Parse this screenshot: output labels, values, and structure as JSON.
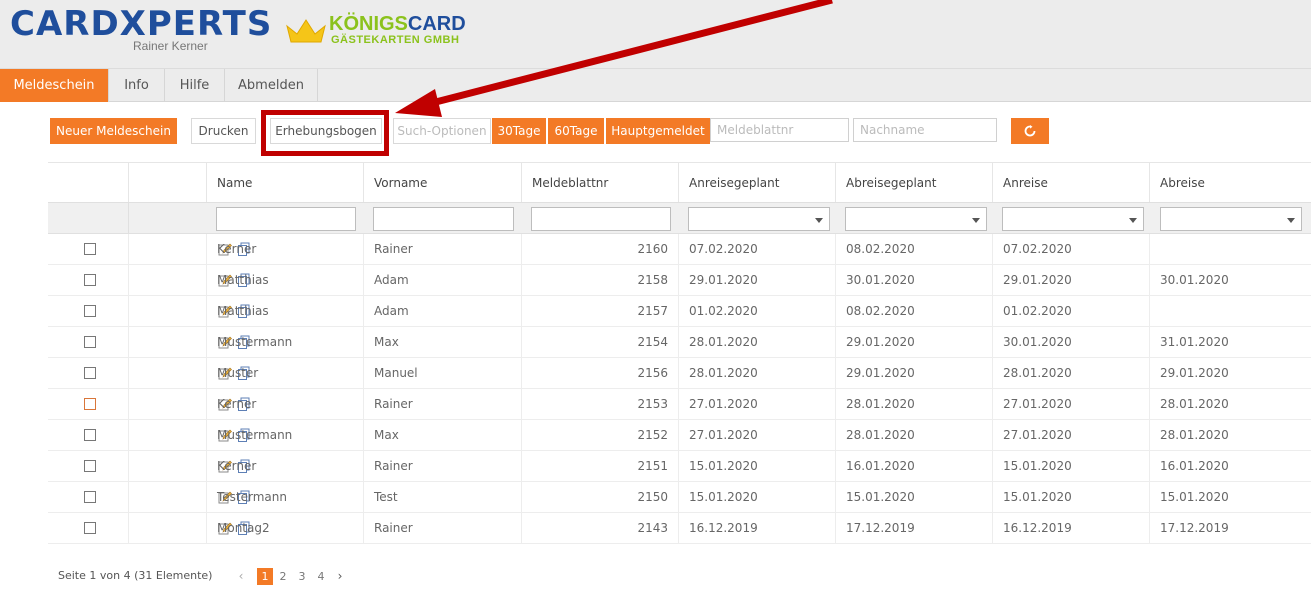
{
  "logo": {
    "brand": "CARDXPERTS",
    "owner": "Rainer Kerner",
    "partner_prefix": "KÖNIGS",
    "partner_suffix": "CARD",
    "partner_sub": "GÄSTEKARTEN GMBH"
  },
  "nav": {
    "items": [
      {
        "label": "Meldeschein",
        "active": true
      },
      {
        "label": "Info",
        "active": false
      },
      {
        "label": "Hilfe",
        "active": false
      },
      {
        "label": "Abmelden",
        "active": false
      }
    ]
  },
  "toolbar": {
    "new_label": "Neuer Meldeschein",
    "print_label": "Drucken",
    "survey_label": "Erhebungsbogen",
    "search_options_label": "Such-Optionen",
    "days30_label": "30Tage",
    "days60_label": "60Tage",
    "main_label": "Hauptgemeldet",
    "meldeblatt_placeholder": "Meldeblattnr",
    "name_placeholder": "Nachname",
    "refresh_icon": "refresh-icon"
  },
  "grid": {
    "columns": [
      "",
      "",
      "Name",
      "Vorname",
      "Meldeblattnr",
      "Anreisegeplant",
      "Abreisegeplant",
      "Anreise",
      "Abreise"
    ],
    "rows": [
      {
        "name": "Kerner",
        "vorname": "Rainer",
        "nr": "2160",
        "anreise_geplant": "07.02.2020",
        "abreise_geplant": "08.02.2020",
        "anreise": "07.02.2020",
        "abreise": ""
      },
      {
        "name": "Matthias",
        "vorname": "Adam",
        "nr": "2158",
        "anreise_geplant": "29.01.2020",
        "abreise_geplant": "30.01.2020",
        "anreise": "29.01.2020",
        "abreise": "30.01.2020"
      },
      {
        "name": "Matthias",
        "vorname": "Adam",
        "nr": "2157",
        "anreise_geplant": "01.02.2020",
        "abreise_geplant": "08.02.2020",
        "anreise": "01.02.2020",
        "abreise": ""
      },
      {
        "name": "Mustermann",
        "vorname": "Max",
        "nr": "2154",
        "anreise_geplant": "28.01.2020",
        "abreise_geplant": "29.01.2020",
        "anreise": "30.01.2020",
        "abreise": "31.01.2020"
      },
      {
        "name": "Muster",
        "vorname": "Manuel",
        "nr": "2156",
        "anreise_geplant": "28.01.2020",
        "abreise_geplant": "29.01.2020",
        "anreise": "28.01.2020",
        "abreise": "29.01.2020"
      },
      {
        "name": "Kerner",
        "vorname": "Rainer",
        "nr": "2153",
        "anreise_geplant": "27.01.2020",
        "abreise_geplant": "28.01.2020",
        "anreise": "27.01.2020",
        "abreise": "28.01.2020"
      },
      {
        "name": "Mustermann",
        "vorname": "Max",
        "nr": "2152",
        "anreise_geplant": "27.01.2020",
        "abreise_geplant": "28.01.2020",
        "anreise": "27.01.2020",
        "abreise": "28.01.2020"
      },
      {
        "name": "Kerner",
        "vorname": "Rainer",
        "nr": "2151",
        "anreise_geplant": "15.01.2020",
        "abreise_geplant": "16.01.2020",
        "anreise": "15.01.2020",
        "abreise": "16.01.2020"
      },
      {
        "name": "Testermann",
        "vorname": "Test",
        "nr": "2150",
        "anreise_geplant": "15.01.2020",
        "abreise_geplant": "15.01.2020",
        "anreise": "15.01.2020",
        "abreise": "15.01.2020"
      },
      {
        "name": "Montag2",
        "vorname": "Rainer",
        "nr": "2143",
        "anreise_geplant": "16.12.2019",
        "abreise_geplant": "17.12.2019",
        "anreise": "16.12.2019",
        "abreise": "17.12.2019"
      }
    ]
  },
  "pager": {
    "info": "Seite 1 von 4 (31 Elemente)",
    "pages": [
      "1",
      "2",
      "3",
      "4"
    ],
    "current": "1"
  },
  "colors": {
    "accent": "#f37a26",
    "brand_blue": "#1f4e9c",
    "brand_green": "#8bc21c",
    "annotation_red": "#c00000"
  }
}
